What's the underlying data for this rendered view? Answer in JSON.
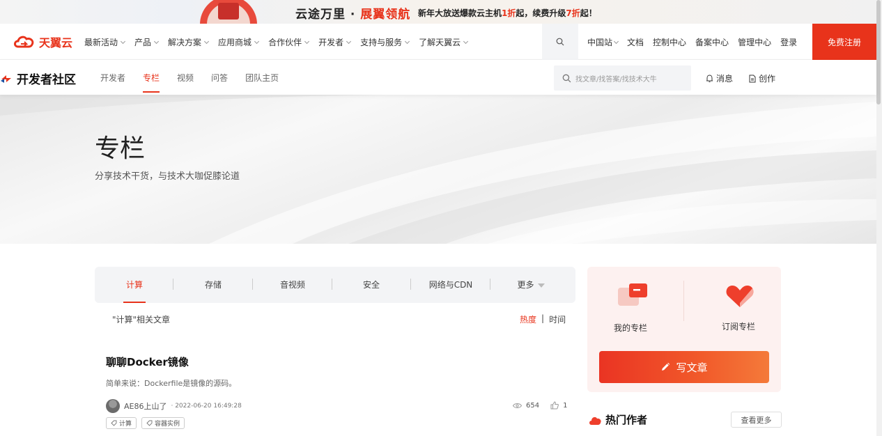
{
  "promo": {
    "title_a": "云途万里 · ",
    "title_b": "展翼领航",
    "text_a": "新年大放送爆款云主机",
    "text_b": "1折",
    "text_c": "起，续费升级",
    "text_d": "7折",
    "text_e": "起！"
  },
  "mainnav": {
    "logo": "天翼云",
    "items": [
      "最新活动",
      "产品",
      "解决方案",
      "应用商城",
      "合作伙伴",
      "开发者",
      "支持与服务",
      "了解天翼云"
    ],
    "region": "中国站",
    "links": [
      "文档",
      "控制中心",
      "备案中心",
      "管理中心",
      "登录"
    ],
    "register": "免费注册"
  },
  "devnav": {
    "logo": "开发者社区",
    "tabs": [
      "开发者",
      "专栏",
      "视频",
      "问答",
      "团队主页"
    ],
    "search_placeholder": "找文章/找答案/找技术大牛",
    "messages": "消息",
    "create": "创作"
  },
  "hero": {
    "title": "专栏",
    "subtitle": "分享技术干货，与技术大咖促膝论道"
  },
  "categories": [
    "计算",
    "存储",
    "音视频",
    "安全",
    "网络与CDN",
    "更多"
  ],
  "list": {
    "related": "\"计算\"相关文章",
    "sort_hot": "热度",
    "sort_sep": "|",
    "sort_time": "时间"
  },
  "article": {
    "title": "聊聊Docker镜像",
    "desc": "简单来说：Dockerfile是镜像的源码。",
    "author": "AE86上山了",
    "date": "· 2022-06-20 16:49:28",
    "views": "654",
    "likes": "1",
    "tags": [
      "计算",
      "容器实例"
    ]
  },
  "side": {
    "my_column": "我的专栏",
    "subscribe": "订阅专栏",
    "write": "写文章",
    "hot_authors": "热门作者",
    "see_more": "查看更多"
  },
  "colors": {
    "accent": "#e8331b",
    "panel": "#fdf1f0"
  }
}
